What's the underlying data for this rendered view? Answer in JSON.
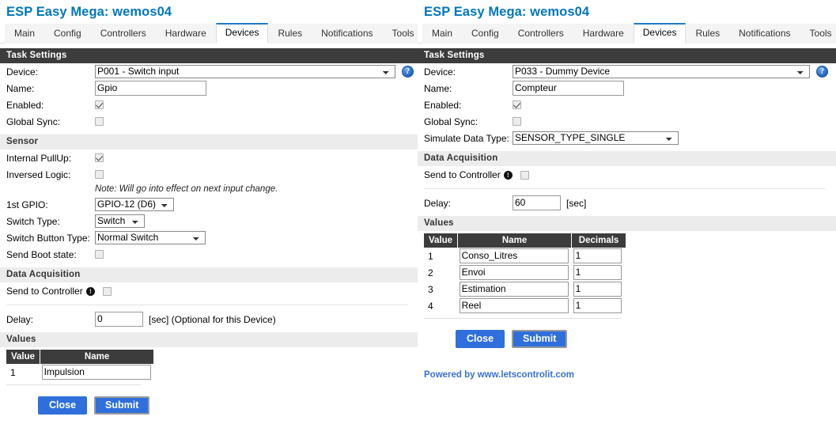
{
  "panels": [
    {
      "title": "ESP Easy Mega: wemos04",
      "tabs": [
        {
          "label": "Main",
          "active": false
        },
        {
          "label": "Config",
          "active": false
        },
        {
          "label": "Controllers",
          "active": false
        },
        {
          "label": "Hardware",
          "active": false
        },
        {
          "label": "Devices",
          "active": true
        },
        {
          "label": "Rules",
          "active": false
        },
        {
          "label": "Notifications",
          "active": false
        },
        {
          "label": "Tools",
          "active": false
        }
      ],
      "task_settings": {
        "header": "Task Settings",
        "device_label": "Device:",
        "device_value": "P001 - Switch input",
        "name_label": "Name:",
        "name_value": "Gpio",
        "enabled_label": "Enabled:",
        "enabled_checked": true,
        "global_sync_label": "Global Sync:",
        "global_sync_checked": false,
        "help_icon": "?"
      },
      "sensor": {
        "header": "Sensor",
        "internal_pullup_label": "Internal PullUp:",
        "internal_pullup_checked": true,
        "inversed_logic_label": "Inversed Logic:",
        "inversed_logic_checked": false,
        "note": "Note: Will go into effect on next input change.",
        "gpio_label": "1st GPIO:",
        "gpio_value": "GPIO-12 (D6)",
        "switch_type_label": "Switch Type:",
        "switch_type_value": "Switch",
        "switch_button_type_label": "Switch Button Type:",
        "switch_button_type_value": "Normal Switch",
        "send_boot_state_label": "Send Boot state:",
        "send_boot_state_checked": false
      },
      "data_acquisition": {
        "header": "Data Acquisition",
        "send_to_controller_label": "Send to Controller",
        "send_to_controller_checked": false,
        "info_icon": "!",
        "delay_label": "Delay:",
        "delay_value": "0",
        "delay_unit": "[sec] (Optional for this Device)"
      },
      "values": {
        "header": "Values",
        "columns": [
          "Value",
          "Name"
        ],
        "rows": [
          {
            "index": "1",
            "name": "Impulsion"
          }
        ]
      },
      "buttons": {
        "close": "Close",
        "submit": "Submit"
      },
      "footer": null
    },
    {
      "title": "ESP Easy Mega: wemos04",
      "tabs": [
        {
          "label": "Main",
          "active": false
        },
        {
          "label": "Config",
          "active": false
        },
        {
          "label": "Controllers",
          "active": false
        },
        {
          "label": "Hardware",
          "active": false
        },
        {
          "label": "Devices",
          "active": true
        },
        {
          "label": "Rules",
          "active": false
        },
        {
          "label": "Notifications",
          "active": false
        },
        {
          "label": "Tools",
          "active": false
        }
      ],
      "task_settings": {
        "header": "Task Settings",
        "device_label": "Device:",
        "device_value": "P033 - Dummy Device",
        "name_label": "Name:",
        "name_value": "Compteur",
        "enabled_label": "Enabled:",
        "enabled_checked": true,
        "global_sync_label": "Global Sync:",
        "global_sync_checked": false,
        "simulate_label": "Simulate Data Type:",
        "simulate_value": "SENSOR_TYPE_SINGLE",
        "help_icon": "?"
      },
      "data_acquisition": {
        "header": "Data Acquisition",
        "send_to_controller_label": "Send to Controller",
        "send_to_controller_checked": false,
        "info_icon": "!",
        "delay_label": "Delay:",
        "delay_value": "60",
        "delay_unit": "[sec]"
      },
      "values": {
        "header": "Values",
        "columns": [
          "Value",
          "Name",
          "Decimals"
        ],
        "rows": [
          {
            "index": "1",
            "name": "Conso_Litres",
            "decimals": "1"
          },
          {
            "index": "2",
            "name": "Envoi",
            "decimals": "1"
          },
          {
            "index": "3",
            "name": "Estimation",
            "decimals": "1"
          },
          {
            "index": "4",
            "name": "Reel",
            "decimals": "1"
          }
        ]
      },
      "buttons": {
        "close": "Close",
        "submit": "Submit"
      },
      "footer": "Powered by www.letscontrolit.com"
    }
  ],
  "colors": {
    "accent": "#2f6fdb",
    "title": "#0077bb",
    "section_dark": "#3c3c3c",
    "section_light": "#ececec",
    "tab_active_border": "#1d7ac7"
  }
}
